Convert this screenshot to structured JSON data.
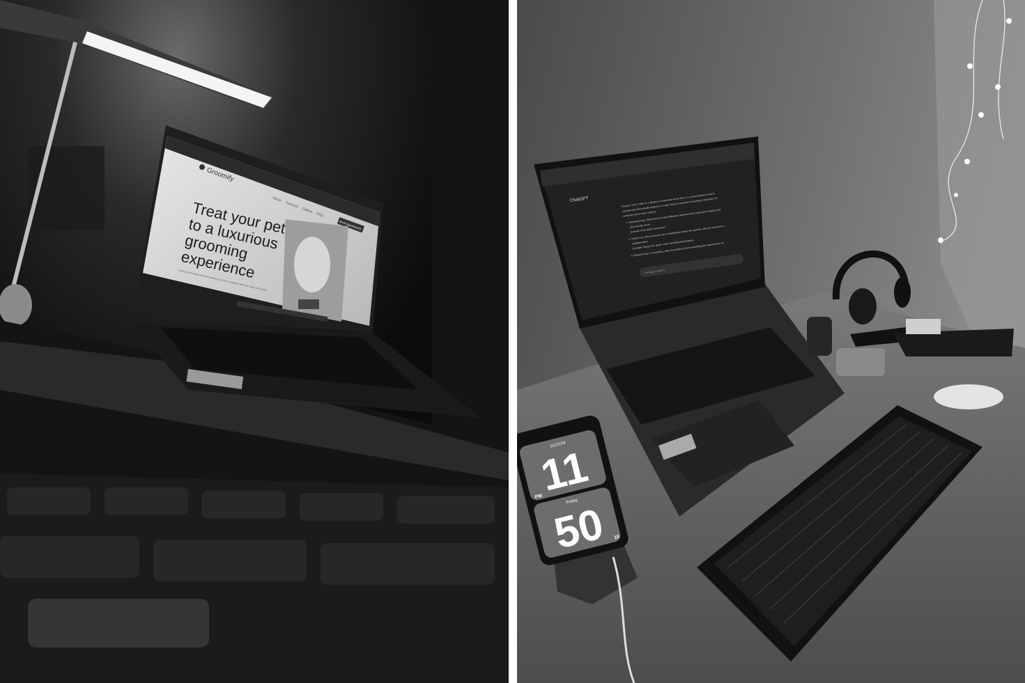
{
  "left_photo": {
    "website_brand": "Groomify",
    "hero_lines": [
      "Treat your pet",
      "to a luxurious",
      "grooming",
      "experience"
    ],
    "hero_subtext": "Luxury pet grooming tailored to pamper your furry companion with care, style and comfort.",
    "nav_items": [
      "About",
      "Services",
      "Gallery",
      "FAQ"
    ],
    "cta_button": "Book Appointment"
  },
  "right_photo": {
    "chat_app_title": "ChatGPT",
    "chat_lines": [
      "The term \"ironic\" refers to a situation or expression where there is a contrast between what is",
      "expected and what actually happens or is said, often in a way that is amusing or surprising. It is",
      "commonly used in three contexts:",
      "1. Situational Irony: When there is a stark difference between what is expected to happen and",
      "what actually occurs.",
      "Example: A fire station burns down.",
      "2. Verbal Irony: When someone says something but means the opposite, often for humorous or",
      "emphatic effect.",
      "Example: Saying \"Oh, great!\" when something bad happens.",
      "3. Dramatic Irony: In storytelling, when the audience knows something the characters do not."
    ],
    "message_placeholder": "Message ChatGPT",
    "phone_clock": {
      "date": "11/22/24",
      "hour": "11",
      "minute": "50",
      "ampm": "PM",
      "day": "Friday",
      "seconds": "10"
    }
  },
  "colors": {
    "divider": "#ffffff",
    "left_bg": "#0e0e0e",
    "wall": "#6a6a6a"
  }
}
